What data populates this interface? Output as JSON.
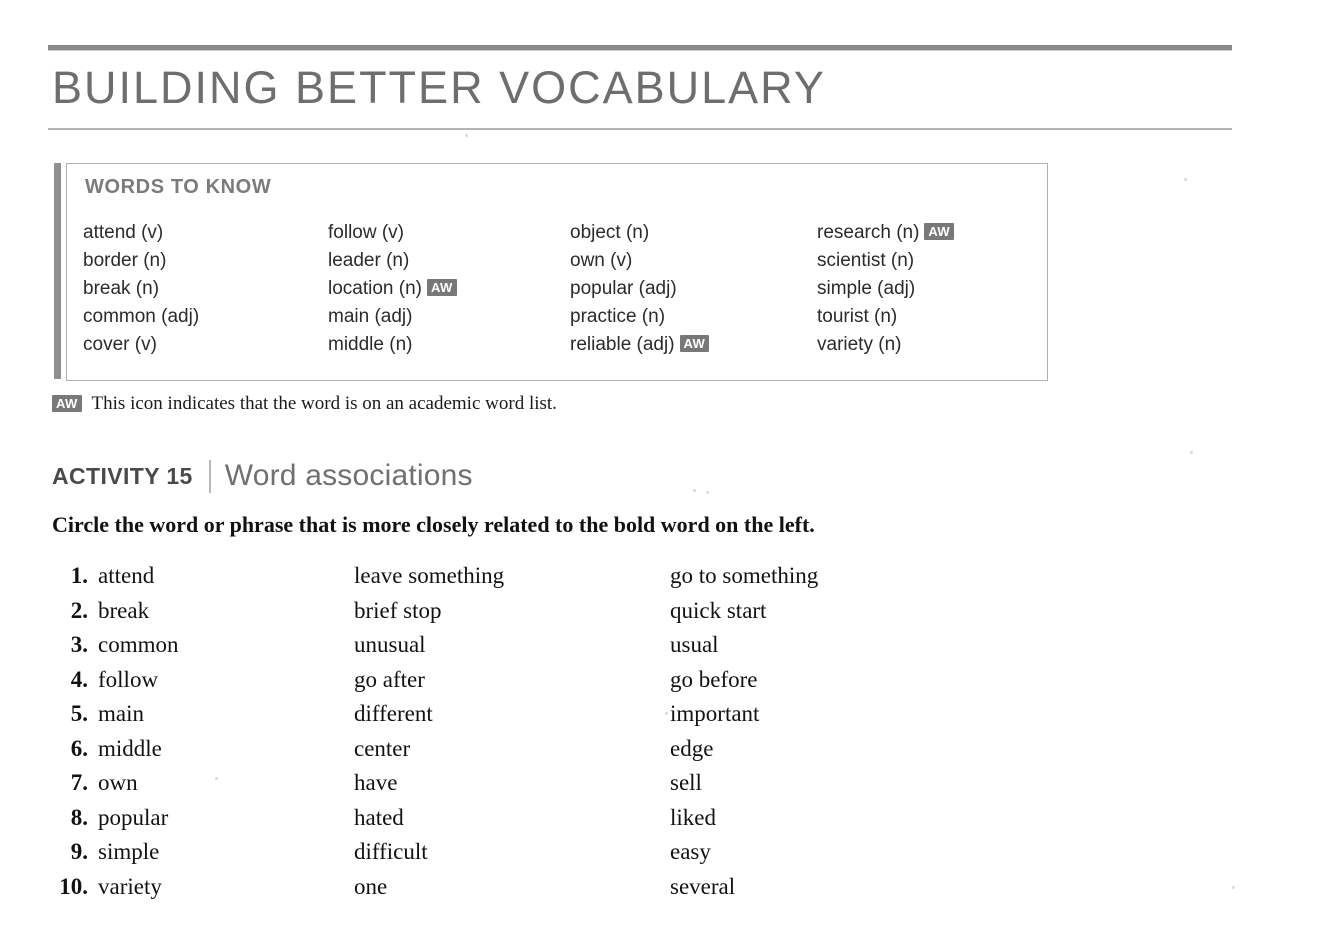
{
  "page": {
    "title": "BUILDING BETTER VOCABULARY"
  },
  "words_to_know": {
    "heading": "WORDS TO KNOW",
    "badge_label": "AW",
    "columns": [
      [
        {
          "text": "attend (v)",
          "aw": false
        },
        {
          "text": "border (n)",
          "aw": false
        },
        {
          "text": "break (n)",
          "aw": false
        },
        {
          "text": "common (adj)",
          "aw": false
        },
        {
          "text": "cover (v)",
          "aw": false
        }
      ],
      [
        {
          "text": "follow (v)",
          "aw": false
        },
        {
          "text": "leader (n)",
          "aw": false
        },
        {
          "text": "location (n)",
          "aw": true
        },
        {
          "text": "main (adj)",
          "aw": false
        },
        {
          "text": "middle (n)",
          "aw": false
        }
      ],
      [
        {
          "text": "object (n)",
          "aw": false
        },
        {
          "text": "own (v)",
          "aw": false
        },
        {
          "text": "popular (adj)",
          "aw": false
        },
        {
          "text": "practice (n)",
          "aw": false
        },
        {
          "text": "reliable (adj)",
          "aw": true
        }
      ],
      [
        {
          "text": "research (n)",
          "aw": true
        },
        {
          "text": "scientist (n)",
          "aw": false
        },
        {
          "text": "simple (adj)",
          "aw": false
        },
        {
          "text": "tourist (n)",
          "aw": false
        },
        {
          "text": "variety (n)",
          "aw": false
        }
      ]
    ]
  },
  "legend": {
    "badge_label": "AW",
    "text": "This icon indicates that the word is on an academic word list."
  },
  "activity": {
    "label": "ACTIVITY 15",
    "title": "Word associations",
    "instruction": "Circle the word or phrase that is more closely related to the bold word on the left.",
    "items": [
      {
        "num": "1.",
        "word": "attend",
        "option_a": "leave something",
        "option_b": "go to something"
      },
      {
        "num": "2.",
        "word": "break",
        "option_a": "brief stop",
        "option_b": "quick start"
      },
      {
        "num": "3.",
        "word": "common",
        "option_a": "unusual",
        "option_b": "usual"
      },
      {
        "num": "4.",
        "word": "follow",
        "option_a": "go after",
        "option_b": "go before"
      },
      {
        "num": "5.",
        "word": "main",
        "option_a": "different",
        "option_b": "important"
      },
      {
        "num": "6.",
        "word": "middle",
        "option_a": "center",
        "option_b": "edge"
      },
      {
        "num": "7.",
        "word": "own",
        "option_a": "have",
        "option_b": "sell"
      },
      {
        "num": "8.",
        "word": "popular",
        "option_a": "hated",
        "option_b": "liked"
      },
      {
        "num": "9.",
        "word": "simple",
        "option_a": "difficult",
        "option_b": "easy"
      },
      {
        "num": "10.",
        "word": "variety",
        "option_a": "one",
        "option_b": "several"
      }
    ]
  },
  "colors": {
    "rule": "#8a8a8a",
    "title_gray": "#6e6e6e",
    "badge_gray": "#787878",
    "heading_gray": "#7b7b7b",
    "text_black": "#121212"
  }
}
